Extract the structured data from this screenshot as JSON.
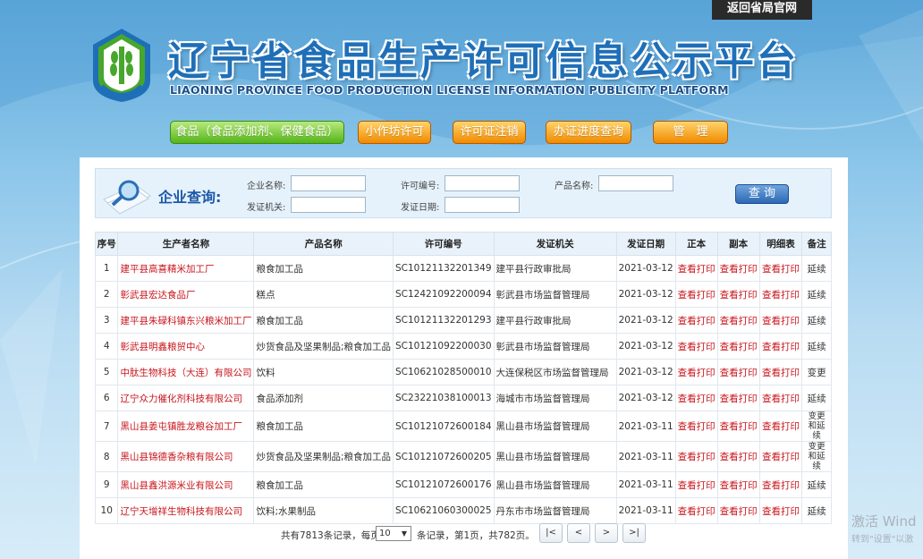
{
  "top_link": "返回省局官网",
  "header": {
    "title": "辽宁省食品生产许可信息公示平台",
    "subtitle": "LIAONING PROVINCE FOOD PRODUCTION LICENSE INFORMATION PUBLICITY PLATFORM"
  },
  "nav": [
    {
      "label": "食品（食品添加剂、保健食品）",
      "active": true
    },
    {
      "label": "小作坊许可",
      "active": false
    },
    {
      "label": "许可证注销",
      "active": false
    },
    {
      "label": "办证进度查询",
      "active": false
    },
    {
      "label": "管　理",
      "active": false
    }
  ],
  "search": {
    "title": "企业查询:",
    "labels": {
      "company_name": "企业名称:",
      "license_no": "许可编号:",
      "product_name": "产品名称:",
      "issuer": "发证机关:",
      "issue_date": "发证日期:"
    },
    "button": "查 询"
  },
  "table": {
    "headers": [
      "序号",
      "生产者名称",
      "产品名称",
      "许可编号",
      "发证机关",
      "发证日期",
      "正本",
      "副本",
      "明细表",
      "备注"
    ],
    "rows": [
      [
        "1",
        "建平县高喜精米加工厂",
        "粮食加工品",
        "SC10121132201349",
        "建平县行政审批局",
        "2021-03-12",
        "查看打印",
        "查看打印",
        "查看打印",
        "延续"
      ],
      [
        "2",
        "彰武县宏达食品厂",
        "糕点",
        "SC12421092200094",
        "彰武县市场监督管理局",
        "2021-03-12",
        "查看打印",
        "查看打印",
        "查看打印",
        "延续"
      ],
      [
        "3",
        "建平县朱碌科镇东兴粮米加工厂",
        "粮食加工品",
        "SC10121132201293",
        "建平县行政审批局",
        "2021-03-12",
        "查看打印",
        "查看打印",
        "查看打印",
        "延续"
      ],
      [
        "4",
        "彰武县明鑫粮贸中心",
        "炒货食品及坚果制品;粮食加工品",
        "SC10121092200030",
        "彰武县市场监督管理局",
        "2021-03-12",
        "查看打印",
        "查看打印",
        "查看打印",
        "延续"
      ],
      [
        "5",
        "中肽生物科技（大连）有限公司",
        "饮料",
        "SC10621028500010",
        "大连保税区市场监督管理局",
        "2021-03-12",
        "查看打印",
        "查看打印",
        "查看打印",
        "变更"
      ],
      [
        "6",
        "辽宁众力催化剂科技有限公司",
        "食品添加剂",
        "SC23221038100013",
        "海城市市场监督管理局",
        "2021-03-12",
        "查看打印",
        "查看打印",
        "查看打印",
        "延续"
      ],
      [
        "7",
        "黑山县姜屯镇胜龙粮谷加工厂",
        "粮食加工品",
        "SC10121072600184",
        "黑山县市场监督管理局",
        "2021-03-11",
        "查看打印",
        "查看打印",
        "查看打印",
        "变更和延续"
      ],
      [
        "8",
        "黑山县锦德香杂粮有限公司",
        "炒货食品及坚果制品;粮食加工品",
        "SC10121072600205",
        "黑山县市场监督管理局",
        "2021-03-11",
        "查看打印",
        "查看打印",
        "查看打印",
        "变更和延续"
      ],
      [
        "9",
        "黑山县鑫洪源米业有限公司",
        "粮食加工品",
        "SC10121072600176",
        "黑山县市场监督管理局",
        "2021-03-11",
        "查看打印",
        "查看打印",
        "查看打印",
        "延续"
      ],
      [
        "10",
        "辽宁天增祥生物科技有限公司",
        "饮料;水果制品",
        "SC10621060300025",
        "丹东市市场监督管理局",
        "2021-03-11",
        "查看打印",
        "查看打印",
        "查看打印",
        "延续"
      ]
    ]
  },
  "pager": {
    "prefix": "共有7813条记录，每页",
    "page_size": "10",
    "suffix": "条记录，第1页，共782页。",
    "first": "|<",
    "prev": "<",
    "next": ">",
    "last": ">|"
  },
  "watermark": {
    "line1": "激活 Wind",
    "line2": "转到\"设置\"以激"
  }
}
